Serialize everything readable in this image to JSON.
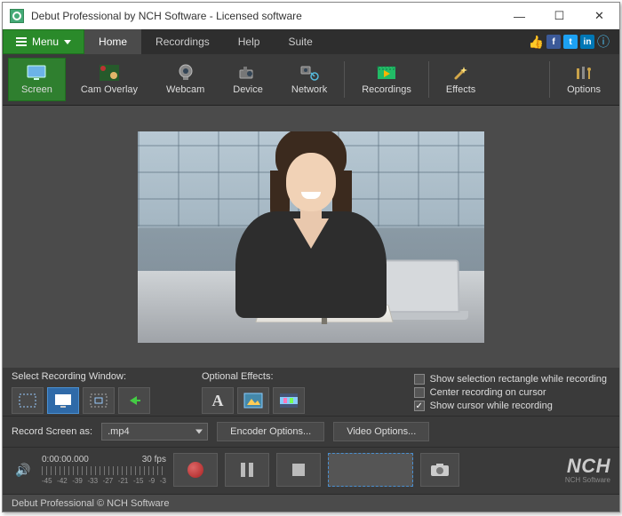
{
  "title": "Debut Professional by NCH Software - Licensed software",
  "menu_button": "Menu",
  "tabs": [
    "Home",
    "Recordings",
    "Help",
    "Suite"
  ],
  "active_tab": 0,
  "toolbar": {
    "screen": "Screen",
    "cam_overlay": "Cam Overlay",
    "webcam": "Webcam",
    "device": "Device",
    "network": "Network",
    "recordings": "Recordings",
    "effects": "Effects",
    "options": "Options"
  },
  "controls": {
    "select_window_label": "Select Recording Window:",
    "optional_effects_label": "Optional Effects:",
    "check_selection_rect": "Show selection rectangle while recording",
    "check_center_cursor": "Center recording on cursor",
    "check_show_cursor": "Show cursor while recording",
    "record_as_label": "Record Screen as:",
    "format_value": ".mp4",
    "encoder_btn": "Encoder Options...",
    "video_btn": "Video Options..."
  },
  "transport": {
    "timecode": "0:00:00.000",
    "fps": "30 fps",
    "ticks": [
      "-45",
      "-42",
      "-39",
      "-33",
      "-27",
      "-21",
      "-15",
      "-9",
      "-3"
    ]
  },
  "branding": {
    "logo": "NCH",
    "sub": "NCH Software"
  },
  "status": "Debut Professional  © NCH Software"
}
